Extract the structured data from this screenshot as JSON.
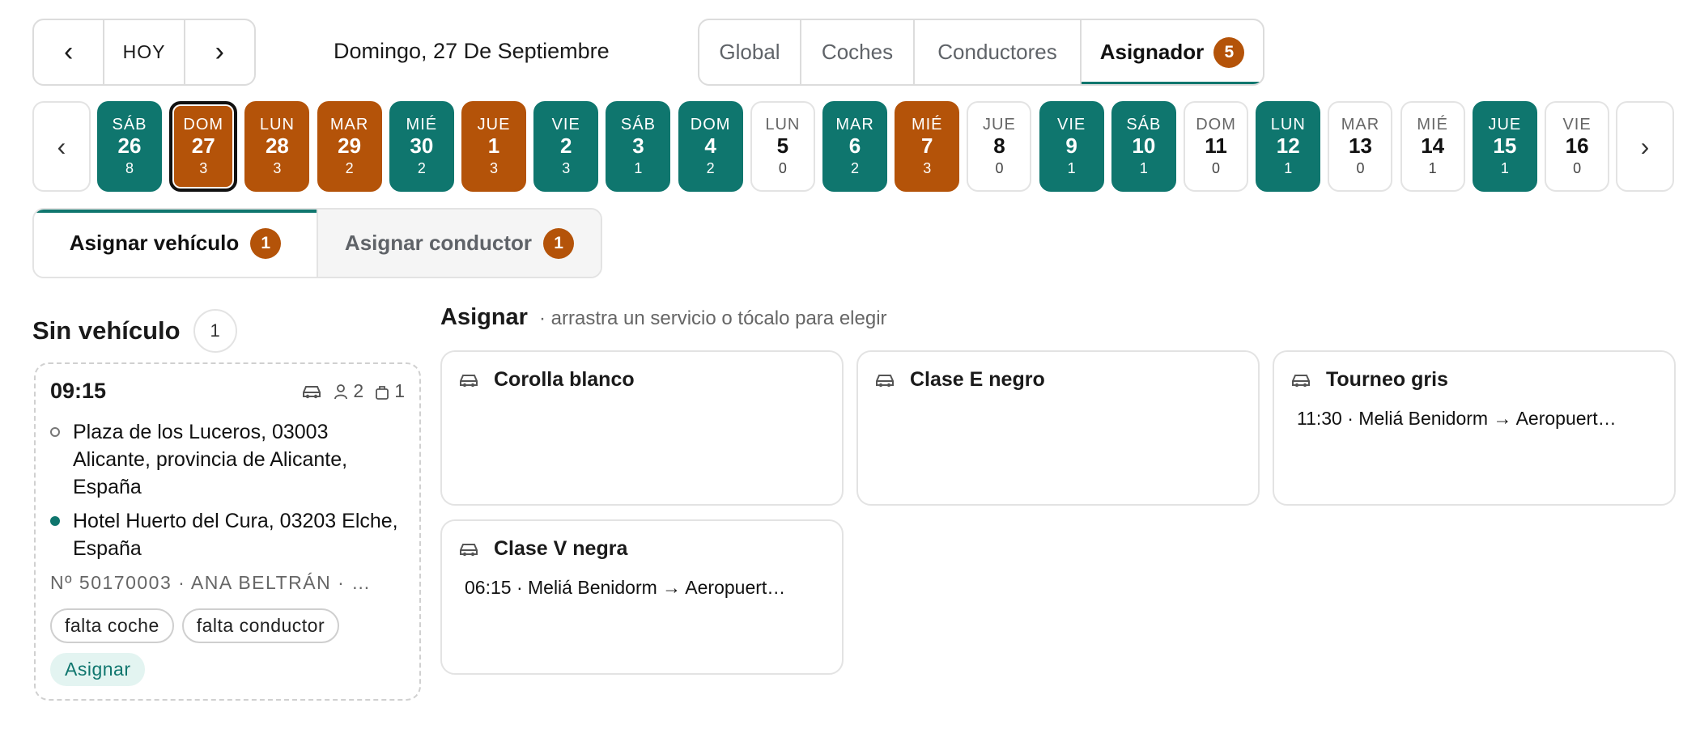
{
  "nav": {
    "prev": "‹",
    "today": "HOY",
    "next": "›"
  },
  "date_title": "Domingo, 27 De Septiembre",
  "view_tabs": [
    {
      "label": "Global"
    },
    {
      "label": "Coches"
    },
    {
      "label": "Conductores"
    },
    {
      "label": "Asignador",
      "badge": "5",
      "active": true
    }
  ],
  "strip": {
    "prev": "‹",
    "next": "›"
  },
  "days": [
    {
      "dw": "SÁB",
      "dn": "26",
      "dc": "8",
      "state": "teal"
    },
    {
      "dw": "DOM",
      "dn": "27",
      "dc": "3",
      "state": "orange",
      "selected": true
    },
    {
      "dw": "LUN",
      "dn": "28",
      "dc": "3",
      "state": "orange"
    },
    {
      "dw": "MAR",
      "dn": "29",
      "dc": "2",
      "state": "orange"
    },
    {
      "dw": "MIÉ",
      "dn": "30",
      "dc": "2",
      "state": "teal"
    },
    {
      "dw": "JUE",
      "dn": "1",
      "dc": "3",
      "state": "orange"
    },
    {
      "dw": "VIE",
      "dn": "2",
      "dc": "3",
      "state": "teal"
    },
    {
      "dw": "SÁB",
      "dn": "3",
      "dc": "1",
      "state": "teal"
    },
    {
      "dw": "DOM",
      "dn": "4",
      "dc": "2",
      "state": "teal"
    },
    {
      "dw": "LUN",
      "dn": "5",
      "dc": "0",
      "state": "plain"
    },
    {
      "dw": "MAR",
      "dn": "6",
      "dc": "2",
      "state": "teal"
    },
    {
      "dw": "MIÉ",
      "dn": "7",
      "dc": "3",
      "state": "orange"
    },
    {
      "dw": "JUE",
      "dn": "8",
      "dc": "0",
      "state": "plain"
    },
    {
      "dw": "VIE",
      "dn": "9",
      "dc": "1",
      "state": "teal"
    },
    {
      "dw": "SÁB",
      "dn": "10",
      "dc": "1",
      "state": "teal"
    },
    {
      "dw": "DOM",
      "dn": "11",
      "dc": "0",
      "state": "plain"
    },
    {
      "dw": "LUN",
      "dn": "12",
      "dc": "1",
      "state": "teal"
    },
    {
      "dw": "MAR",
      "dn": "13",
      "dc": "0",
      "state": "plain"
    },
    {
      "dw": "MIÉ",
      "dn": "14",
      "dc": "1",
      "state": "plain"
    },
    {
      "dw": "JUE",
      "dn": "15",
      "dc": "1",
      "state": "teal"
    },
    {
      "dw": "VIE",
      "dn": "16",
      "dc": "0",
      "state": "plain"
    }
  ],
  "assign_tabs": [
    {
      "label": "Asignar vehículo",
      "badge": "1",
      "active": true
    },
    {
      "label": "Asignar conductor",
      "badge": "1",
      "active": false
    }
  ],
  "unassigned": {
    "title": "Sin vehículo",
    "count": "1",
    "service": {
      "time": "09:15",
      "passengers": "2",
      "bags": "1",
      "origin": "Plaza de los Luceros, 03003 Alicante, provincia de Alicante, España",
      "destination": "Hotel Huerto del Cura, 03203 Elche, España",
      "ref": "Nº 50170003 · ANA BELTRÁN · …",
      "tags": [
        "falta coche",
        "falta conductor"
      ],
      "action": "Asignar"
    }
  },
  "assign_area": {
    "title": "Asignar",
    "hint": "· arrastra un servicio o tócalo para elegir",
    "vehicles": [
      {
        "name": "Corolla blanco",
        "service": ""
      },
      {
        "name": "Clase E negro",
        "service": ""
      },
      {
        "name": "Tourneo gris",
        "service": "11:30 · Meliá Benidorm → Aeropuert…"
      },
      {
        "name": "Clase V negra",
        "service": "06:15 · Meliá Benidorm → Aeropuert…"
      }
    ]
  },
  "colors": {
    "accent": "#0f766e",
    "warning": "#b45309",
    "border": "#e3e3e3"
  },
  "icons": {
    "vehicle": "car-icon",
    "passengers": "person-icon",
    "bags": "bag-icon"
  }
}
